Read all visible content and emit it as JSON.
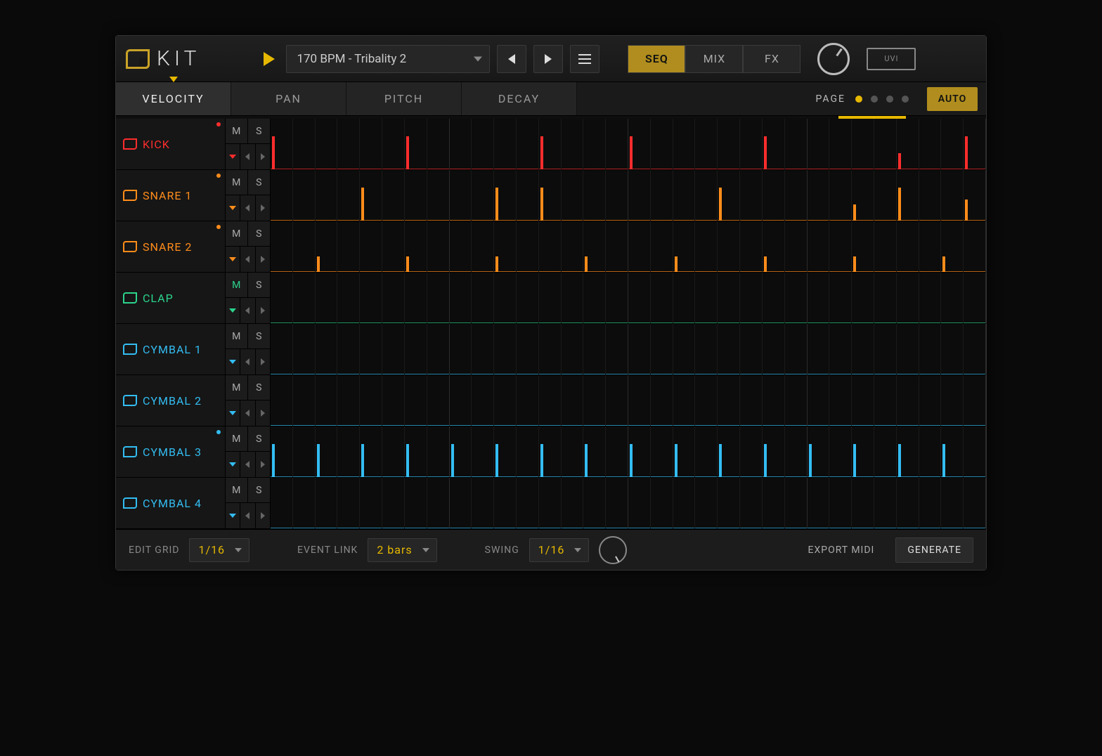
{
  "header": {
    "title": "KIT",
    "preset": "170 BPM - Tribality 2",
    "views": {
      "seq": "SEQ",
      "mix": "MIX",
      "fx": "FX",
      "active": "seq"
    },
    "brand": "UVI"
  },
  "param_tabs": {
    "items": [
      "VELOCITY",
      "PAN",
      "PITCH",
      "DECAY"
    ],
    "active_index": 0,
    "page_label": "PAGE",
    "page_count": 4,
    "page_active": 0,
    "auto_label": "AUTO",
    "auto_on": true
  },
  "playhead": {
    "start_pct": 79.2,
    "width_pct": 9.4
  },
  "colors": {
    "accent": "#e6b800",
    "kick": "#ff2d2d",
    "snare": "#ff8c1a",
    "clap": "#2bd48c",
    "cymbal": "#33bdf2"
  },
  "tracks": [
    {
      "id": "kick",
      "name": "KICK",
      "color": "kick",
      "mute": false,
      "solo": false,
      "led": true,
      "steps": [
        100,
        0,
        0,
        0,
        0,
        0,
        100,
        0,
        0,
        0,
        0,
        0,
        100,
        0,
        0,
        0,
        100,
        0,
        0,
        0,
        0,
        0,
        100,
        0,
        0,
        0,
        0,
        0,
        50,
        0,
        0,
        100
      ]
    },
    {
      "id": "snare1",
      "name": "SNARE 1",
      "color": "snare",
      "mute": false,
      "solo": false,
      "led": true,
      "steps": [
        0,
        0,
        0,
        0,
        100,
        0,
        0,
        0,
        0,
        0,
        100,
        0,
        100,
        0,
        0,
        0,
        0,
        0,
        0,
        0,
        100,
        0,
        0,
        0,
        0,
        0,
        50,
        0,
        100,
        0,
        0,
        65
      ]
    },
    {
      "id": "snare2",
      "name": "SNARE 2",
      "color": "snare",
      "mute": false,
      "solo": false,
      "led": true,
      "steps": [
        0,
        0,
        48,
        0,
        0,
        0,
        48,
        0,
        0,
        0,
        48,
        0,
        0,
        0,
        48,
        0,
        0,
        0,
        48,
        0,
        0,
        0,
        48,
        0,
        0,
        0,
        48,
        0,
        0,
        0,
        48,
        0
      ]
    },
    {
      "id": "clap",
      "name": "CLAP",
      "color": "clap",
      "mute": true,
      "solo": false,
      "led": false,
      "steps": [
        0,
        0,
        0,
        0,
        0,
        0,
        0,
        0,
        0,
        0,
        0,
        0,
        0,
        0,
        0,
        0,
        0,
        0,
        0,
        0,
        0,
        0,
        0,
        0,
        0,
        0,
        0,
        0,
        0,
        0,
        0,
        0
      ]
    },
    {
      "id": "cym1",
      "name": "CYMBAL 1",
      "color": "cymbal",
      "mute": false,
      "solo": false,
      "led": false,
      "steps": [
        0,
        0,
        0,
        0,
        0,
        0,
        0,
        0,
        0,
        0,
        0,
        0,
        0,
        0,
        0,
        0,
        0,
        0,
        0,
        0,
        0,
        0,
        0,
        0,
        0,
        0,
        0,
        0,
        0,
        0,
        0,
        0
      ]
    },
    {
      "id": "cym2",
      "name": "CYMBAL 2",
      "color": "cymbal",
      "mute": false,
      "solo": false,
      "led": false,
      "steps": [
        0,
        0,
        0,
        0,
        0,
        0,
        0,
        0,
        0,
        0,
        0,
        0,
        0,
        0,
        0,
        0,
        0,
        0,
        0,
        0,
        0,
        0,
        0,
        0,
        0,
        0,
        0,
        0,
        0,
        0,
        0,
        0
      ]
    },
    {
      "id": "cym3",
      "name": "CYMBAL 3",
      "color": "cymbal",
      "mute": false,
      "solo": false,
      "led": true,
      "steps": [
        100,
        0,
        100,
        0,
        100,
        0,
        100,
        0,
        100,
        0,
        100,
        0,
        100,
        0,
        100,
        0,
        100,
        0,
        100,
        0,
        100,
        0,
        100,
        0,
        100,
        0,
        100,
        0,
        100,
        0,
        100,
        0
      ]
    },
    {
      "id": "cym4",
      "name": "CYMBAL 4",
      "color": "cymbal",
      "mute": false,
      "solo": false,
      "led": false,
      "steps": [
        0,
        0,
        0,
        0,
        0,
        0,
        0,
        0,
        0,
        0,
        0,
        0,
        0,
        0,
        0,
        0,
        0,
        0,
        0,
        0,
        0,
        0,
        0,
        0,
        0,
        0,
        0,
        0,
        0,
        0,
        0,
        0
      ]
    }
  ],
  "track_controls": {
    "mute_label": "M",
    "solo_label": "S"
  },
  "bottom": {
    "edit_grid_label": "EDIT GRID",
    "edit_grid_value": "1/16",
    "event_link_label": "EVENT LINK",
    "event_link_value": "2 bars",
    "swing_label": "SWING",
    "swing_value": "1/16",
    "export_label": "EXPORT MIDI",
    "generate_label": "GENERATE"
  }
}
